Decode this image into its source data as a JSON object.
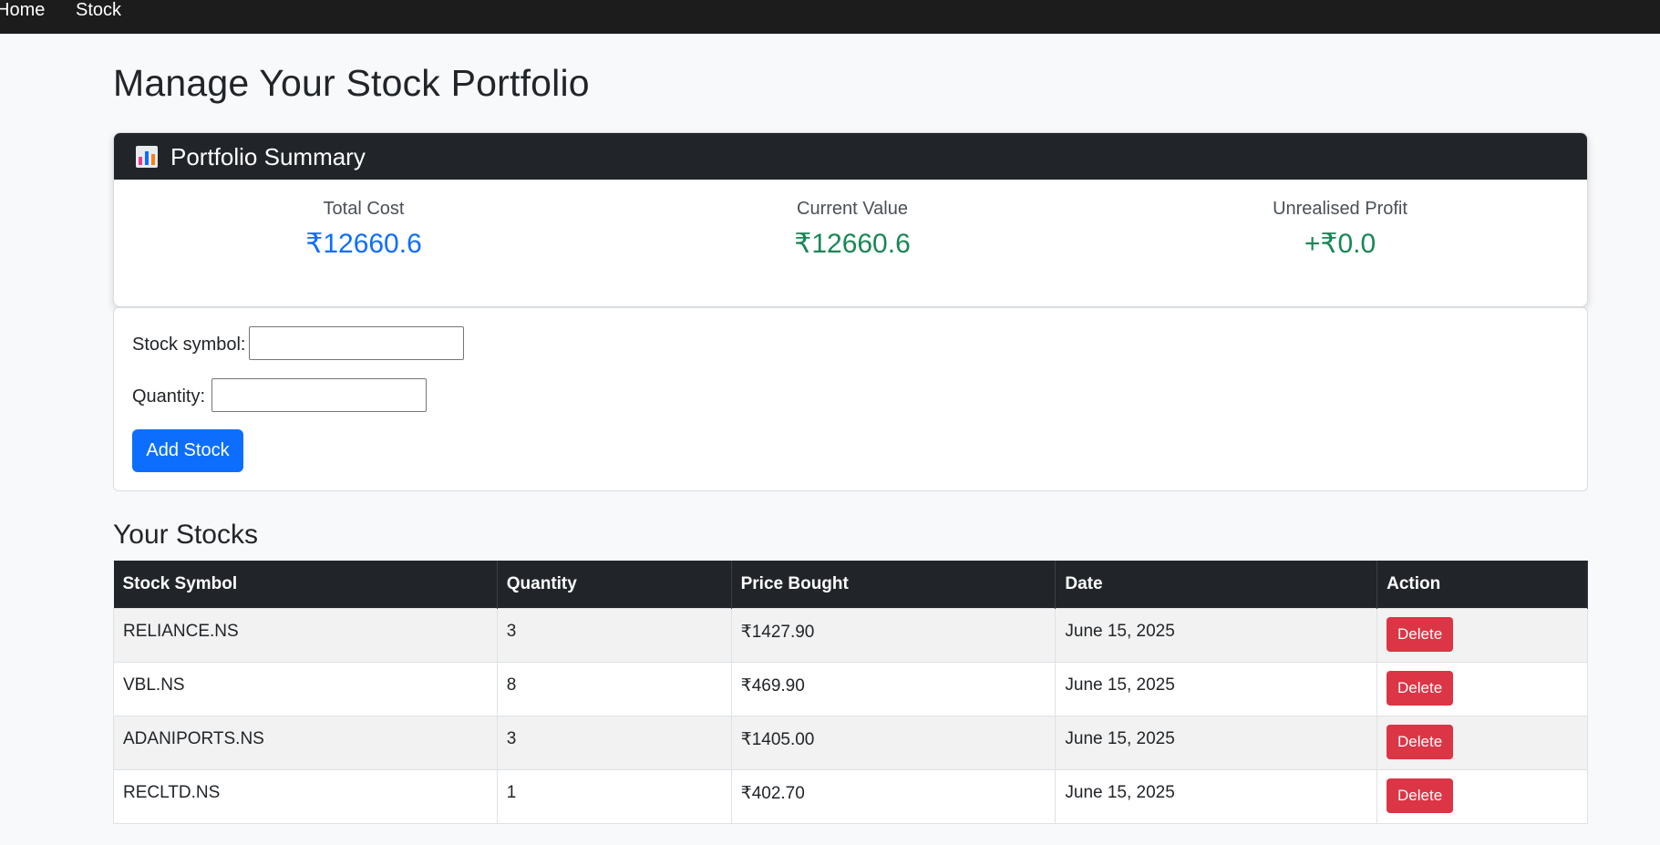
{
  "nav": {
    "home": "Home",
    "stock": "Stock"
  },
  "page_title": "Manage Your Stock Portfolio",
  "summary": {
    "title": "Portfolio Summary",
    "icon": "bar-chart-icon",
    "total_cost_label": "Total Cost",
    "total_cost_value": "₹12660.6",
    "current_value_label": "Current Value",
    "current_value_value": "₹12660.6",
    "profit_label": "Unrealised Profit",
    "profit_value": "+₹0.0",
    "colors": {
      "total_cost": "#0d6efd",
      "current_value": "#198754",
      "profit": "#198754"
    }
  },
  "form": {
    "symbol_label": "Stock symbol:",
    "symbol_value": "",
    "quantity_label": "Quantity:",
    "quantity_value": "",
    "submit_label": "Add Stock"
  },
  "stocks_section_title": "Your Stocks",
  "table": {
    "headers": [
      "Stock Symbol",
      "Quantity",
      "Price Bought",
      "Date",
      "Action"
    ],
    "rows": [
      {
        "symbol": "RELIANCE.NS",
        "quantity": "3",
        "price": "₹1427.90",
        "date": "June 15, 2025",
        "action": "Delete"
      },
      {
        "symbol": "VBL.NS",
        "quantity": "8",
        "price": "₹469.90",
        "date": "June 15, 2025",
        "action": "Delete"
      },
      {
        "symbol": "ADANIPORTS.NS",
        "quantity": "3",
        "price": "₹1405.00",
        "date": "June 15, 2025",
        "action": "Delete"
      },
      {
        "symbol": "RECLTD.NS",
        "quantity": "1",
        "price": "₹402.70",
        "date": "June 15, 2025",
        "action": "Delete"
      }
    ]
  }
}
